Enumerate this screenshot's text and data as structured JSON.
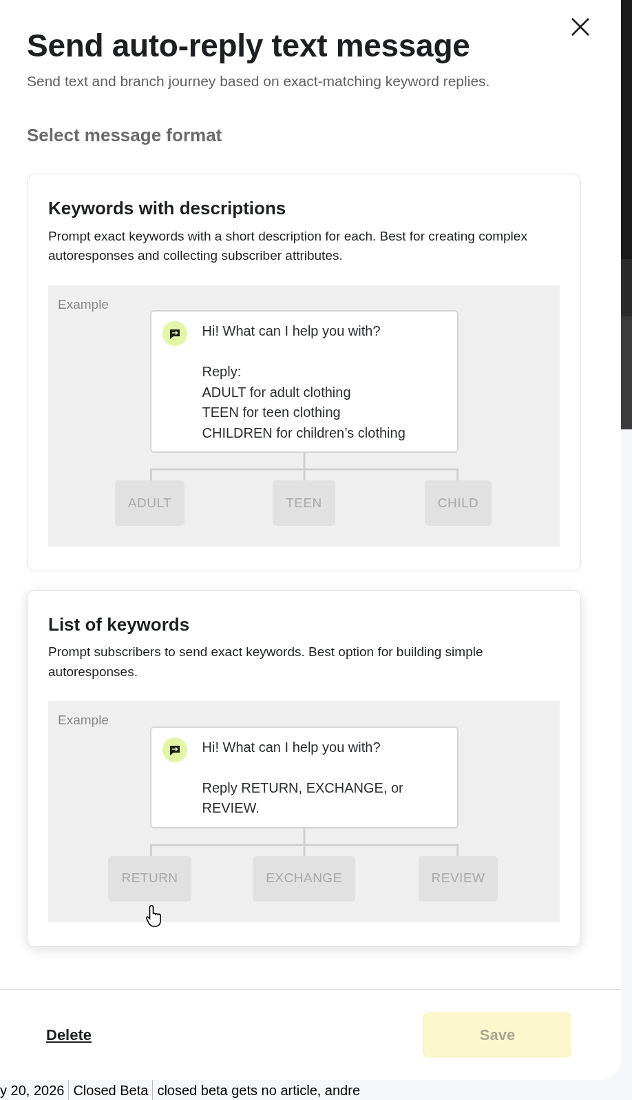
{
  "title": "Send auto-reply text message",
  "subtitle": "Send text and branch journey based on exact-matching keyword replies.",
  "section_label": "Select message format",
  "formats": [
    {
      "title": "Keywords with descriptions",
      "description": "Prompt exact keywords with a short description for each. Best for creating complex autoresponses and collecting subscriber attributes.",
      "hovered": false,
      "example_label": "Example",
      "message": [
        [
          "Hi! What can I help you with?"
        ],
        [
          "Reply:",
          "ADULT for adult clothing",
          "TEEN for teen clothing",
          "CHILDREN for children’s clothing"
        ]
      ],
      "keywords": [
        "ADULT",
        "TEEN",
        "CHILD"
      ]
    },
    {
      "title": "List of keywords",
      "description": "Prompt subscribers to send exact keywords. Best option for building simple autoresponses.",
      "hovered": true,
      "example_label": "Example",
      "message": [
        [
          "Hi! What can I help you with?"
        ],
        [
          "Reply RETURN, EXCHANGE, or REVIEW."
        ]
      ],
      "keywords": [
        "RETURN",
        "EXCHANGE",
        "REVIEW"
      ]
    }
  ],
  "footer": {
    "delete": "Delete",
    "save": {
      "label": "Save",
      "disabled": true
    }
  },
  "background_row": [
    "y 20, 2026",
    "Closed Beta",
    "closed beta gets no article, andre"
  ]
}
